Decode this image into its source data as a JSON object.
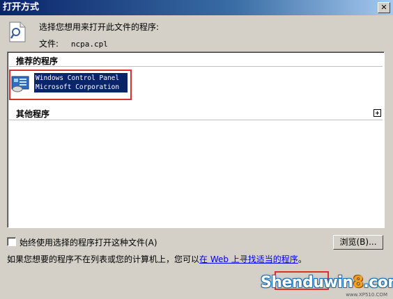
{
  "window": {
    "title": "打开方式",
    "close_glyph": "✕"
  },
  "header": {
    "prompt": "选择您想用来打开此文件的程序:",
    "file_label": "文件:",
    "file_name": "ncpa.cpl"
  },
  "recommended": {
    "header": "推荐的程序",
    "programs": [
      {
        "name": "Windows Control Panel",
        "publisher": "Microsoft Corporation",
        "icon": "control-panel-icon"
      }
    ]
  },
  "other": {
    "header": "其他程序",
    "expand_icon": "plus-box-icon"
  },
  "options": {
    "always_use_label": "始终使用选择的程序打开这种文件(A)",
    "always_use_checked": false,
    "browse_label": "浏览(B)..."
  },
  "footer": {
    "text_before": "如果您想要的程序不在列表或您的计算机上，您可以",
    "link": "在 Web 上寻找适当的程序",
    "text_after": "。"
  },
  "watermark": {
    "text_main": "Shenduwin",
    "text_eight": "8",
    "text_tail": ".com",
    "sub": "www.XP510.COM"
  },
  "colors": {
    "title_bar": "#0a246a",
    "selection": "#0a246a",
    "highlight_box": "#d9302c",
    "link": "#0000ee"
  }
}
